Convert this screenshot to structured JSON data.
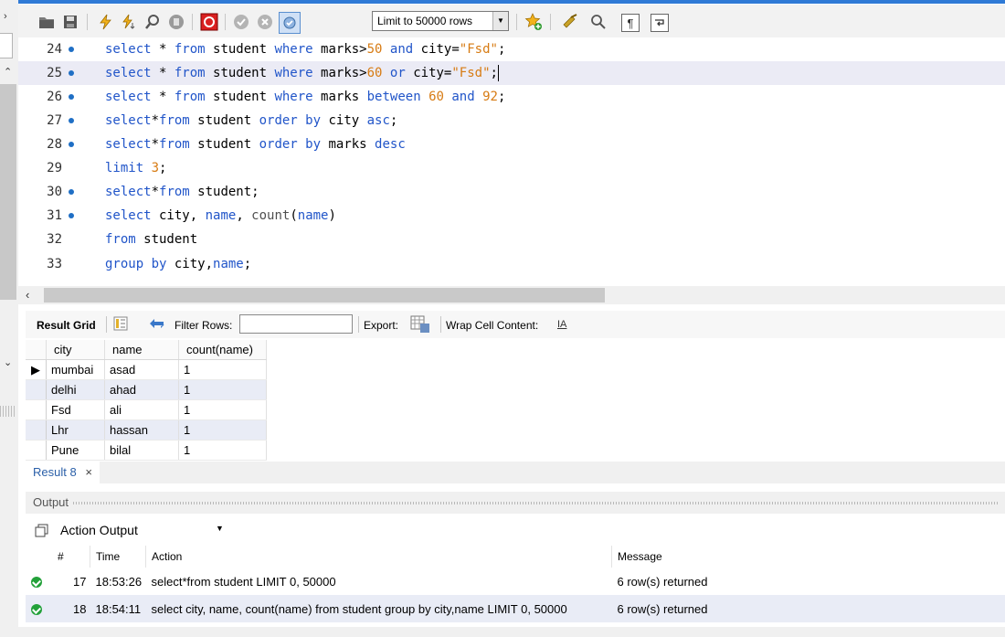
{
  "toolbar": {
    "limit_label": "Limit to 50000 rows"
  },
  "editor": {
    "lines": [
      {
        "num": "24",
        "dot": true
      },
      {
        "num": "25",
        "dot": true
      },
      {
        "num": "26",
        "dot": true
      },
      {
        "num": "27",
        "dot": true
      },
      {
        "num": "28",
        "dot": true
      },
      {
        "num": "29",
        "dot": false
      },
      {
        "num": "30",
        "dot": true
      },
      {
        "num": "31",
        "dot": true
      },
      {
        "num": "32",
        "dot": false
      },
      {
        "num": "33",
        "dot": false
      }
    ]
  },
  "result_toolbar": {
    "result_grid": "Result Grid",
    "filter_rows": "Filter Rows:",
    "export": "Export:",
    "wrap": "Wrap Cell Content:",
    "wrap_icon": "IA"
  },
  "grid": {
    "columns": [
      "city",
      "name",
      "count(name)"
    ],
    "rows": [
      [
        "mumbai",
        "asad",
        "1"
      ],
      [
        "delhi",
        "ahad",
        "1"
      ],
      [
        "Fsd",
        "ali",
        "1"
      ],
      [
        "Lhr",
        "hassan",
        "1"
      ],
      [
        "Pune",
        "bilal",
        "1"
      ]
    ]
  },
  "result_tab": {
    "label": "Result 8",
    "close": "×"
  },
  "output": {
    "title": "Output",
    "selector": "Action Output",
    "columns": [
      "#",
      "Time",
      "Action",
      "Message"
    ],
    "rows": [
      {
        "num": "17",
        "time": "18:53:26",
        "action": "select*from student LIMIT 0, 50000",
        "message": "6 row(s) returned"
      },
      {
        "num": "18",
        "time": "18:54:11",
        "action": "select city, name, count(name) from student group by city,name LIMIT 0, 50000",
        "message": "6 row(s) returned"
      }
    ]
  }
}
